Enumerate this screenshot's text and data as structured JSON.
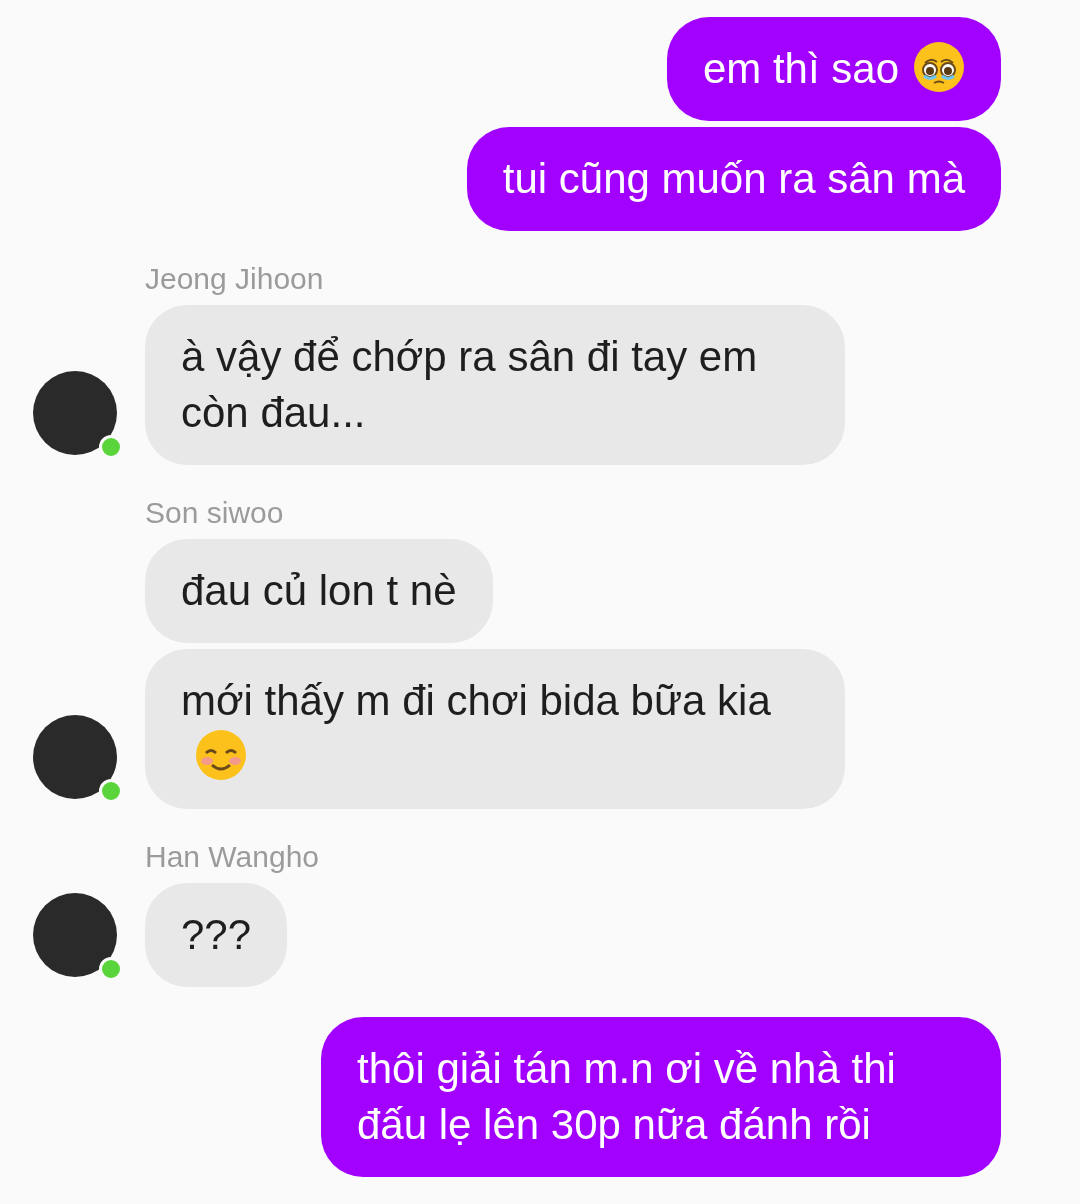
{
  "thread": [
    {
      "kind": "outgoing",
      "bubbles": [
        {
          "text": "em thì sao",
          "kind": "with_teary_face"
        },
        {
          "text": "tui cũng muốn ra sân mà",
          "kind": "plain"
        }
      ]
    },
    {
      "kind": "incoming",
      "sender": "Jeong Jihoon",
      "online": true,
      "bubbles": [
        {
          "text": "à vậy để chớp ra sân đi tay em còn đau...",
          "kind": "plain"
        }
      ]
    },
    {
      "kind": "incoming",
      "sender": "Son siwoo",
      "online": true,
      "bubbles": [
        {
          "text": "đau củ lon t nè",
          "kind": "plain"
        },
        {
          "text": "mới thấy m đi chơi bida bữa kia",
          "kind": "with_smiling_face"
        }
      ]
    },
    {
      "kind": "incoming",
      "sender": "Han Wangho",
      "online": true,
      "bubbles": [
        {
          "text": "???",
          "kind": "plain"
        }
      ]
    },
    {
      "kind": "outgoing",
      "bubbles": [
        {
          "text": "thôi giải tán m.n ơi về nhà thi đấu lẹ lên 30p nữa đánh rồi",
          "kind": "plain"
        }
      ]
    }
  ]
}
